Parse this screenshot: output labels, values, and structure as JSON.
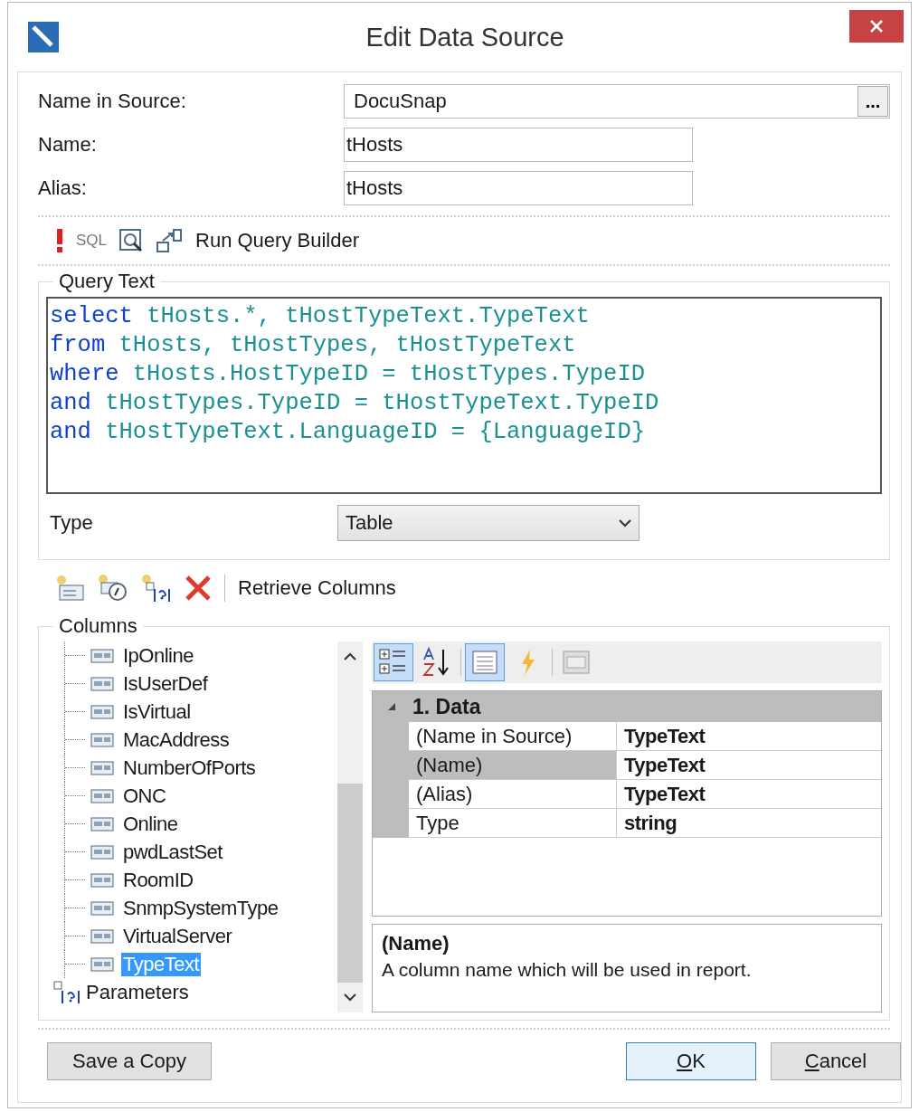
{
  "window": {
    "title": "Edit Data Source"
  },
  "fields": [
    {
      "label": "Name in Source:",
      "value": "DocuSnap",
      "kind": "browse",
      "button": "..."
    },
    {
      "label": "Name:",
      "value": "tHosts",
      "kind": "text"
    },
    {
      "label": "Alias:",
      "value": "tHosts",
      "kind": "text"
    }
  ],
  "query_toolbar": {
    "sql_label": "SQL",
    "run_label": "Run Query Builder"
  },
  "query": {
    "title": "Query Text",
    "lines": [
      {
        "keyword": "select",
        "rest": " tHosts.*, tHostTypeText.TypeText"
      },
      {
        "keyword": "from",
        "rest": " tHosts, tHostTypes, tHostTypeText"
      },
      {
        "keyword": "where",
        "rest": " tHosts.HostTypeID = tHostTypes.TypeID"
      },
      {
        "keyword": "and",
        "rest": " tHostTypes.TypeID = tHostTypeText.TypeID"
      },
      {
        "keyword": "and",
        "rest": " tHostTypeText.LanguageID = {LanguageID}"
      }
    ],
    "type_label": "Type",
    "type_value": "Table"
  },
  "columns_toolbar": {
    "retrieve_label": "Retrieve Columns"
  },
  "columns": {
    "title": "Columns",
    "items": [
      {
        "label": "IpOnline",
        "selected": false
      },
      {
        "label": "IsUserDef",
        "selected": false
      },
      {
        "label": "IsVirtual",
        "selected": false
      },
      {
        "label": "MacAddress",
        "selected": false
      },
      {
        "label": "NumberOfPorts",
        "selected": false
      },
      {
        "label": "ONC",
        "selected": false
      },
      {
        "label": "Online",
        "selected": false
      },
      {
        "label": "pwdLastSet",
        "selected": false
      },
      {
        "label": "RoomID",
        "selected": false
      },
      {
        "label": "SnmpSystemType",
        "selected": false
      },
      {
        "label": "VirtualServer",
        "selected": false
      },
      {
        "label": "TypeText",
        "selected": true
      }
    ],
    "parameters_label": "Parameters"
  },
  "property_toolbar": [
    {
      "kind": "categorized",
      "selected": true
    },
    {
      "kind": "alphabetical",
      "selected": false
    },
    {
      "kind": "separator",
      "selected": false
    },
    {
      "kind": "properties",
      "selected": true
    },
    {
      "kind": "events",
      "selected": false
    },
    {
      "kind": "separator",
      "selected": false
    },
    {
      "kind": "pages",
      "selected": false
    }
  ],
  "property_grid": {
    "category": "1. Data",
    "expanded": true,
    "rows": [
      {
        "name": "(Name in Source)",
        "value": "TypeText",
        "selected": false
      },
      {
        "name": "(Name)",
        "value": "TypeText",
        "selected": true
      },
      {
        "name": "(Alias)",
        "value": "TypeText",
        "selected": false
      },
      {
        "name": "Type",
        "value": "string",
        "selected": false
      }
    ]
  },
  "description": {
    "title": "(Name)",
    "text": "A column name which will be used in report."
  },
  "buttons": [
    {
      "label": "Save a Copy",
      "access_key_underlined": false,
      "default": false
    },
    {
      "label": "OK",
      "access_key_underlined": true,
      "default": true
    },
    {
      "label": "Cancel",
      "access_key_underlined": true,
      "default": false
    }
  ]
}
